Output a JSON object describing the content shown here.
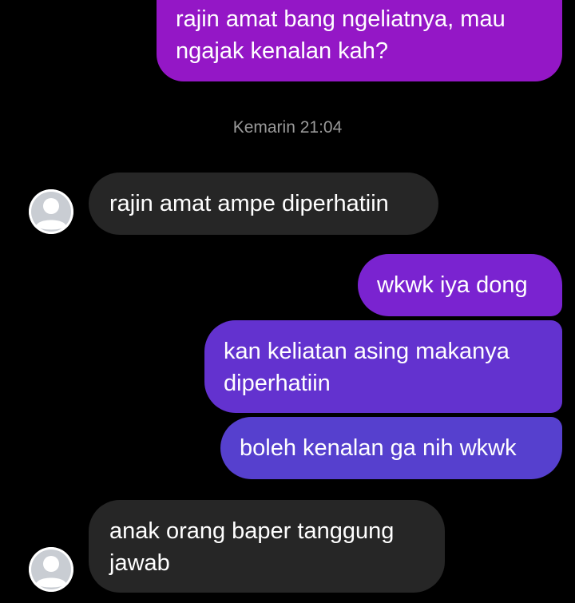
{
  "messages": [
    {
      "direction": "outgoing",
      "lines": [
        "rajin amat bang ngeliatnya, mau",
        "ngajak kenalan kah?"
      ]
    },
    {
      "direction": "timestamp",
      "text": "Kemarin 21:04"
    },
    {
      "direction": "incoming",
      "lines": [
        "rajin amat ampe diperhatiin"
      ]
    },
    {
      "direction": "outgoing",
      "lines": [
        "wkwk iya dong"
      ]
    },
    {
      "direction": "outgoing",
      "lines": [
        "kan keliatan asing makanya",
        "diperhatiin"
      ]
    },
    {
      "direction": "outgoing",
      "lines": [
        "boleh kenalan ga nih wkwk"
      ]
    },
    {
      "direction": "incoming",
      "lines": [
        "anak orang baper tanggung",
        "jawab"
      ]
    }
  ],
  "icons": {
    "avatar": "default-user-avatar-icon"
  },
  "colors": {
    "background": "#000000",
    "incoming_bubble": "#262626",
    "outgoing_gradient": [
      "#9417c6",
      "#7a23d0",
      "#6332cf",
      "#5640ce"
    ],
    "timestamp_text": "#9a9a9a"
  }
}
